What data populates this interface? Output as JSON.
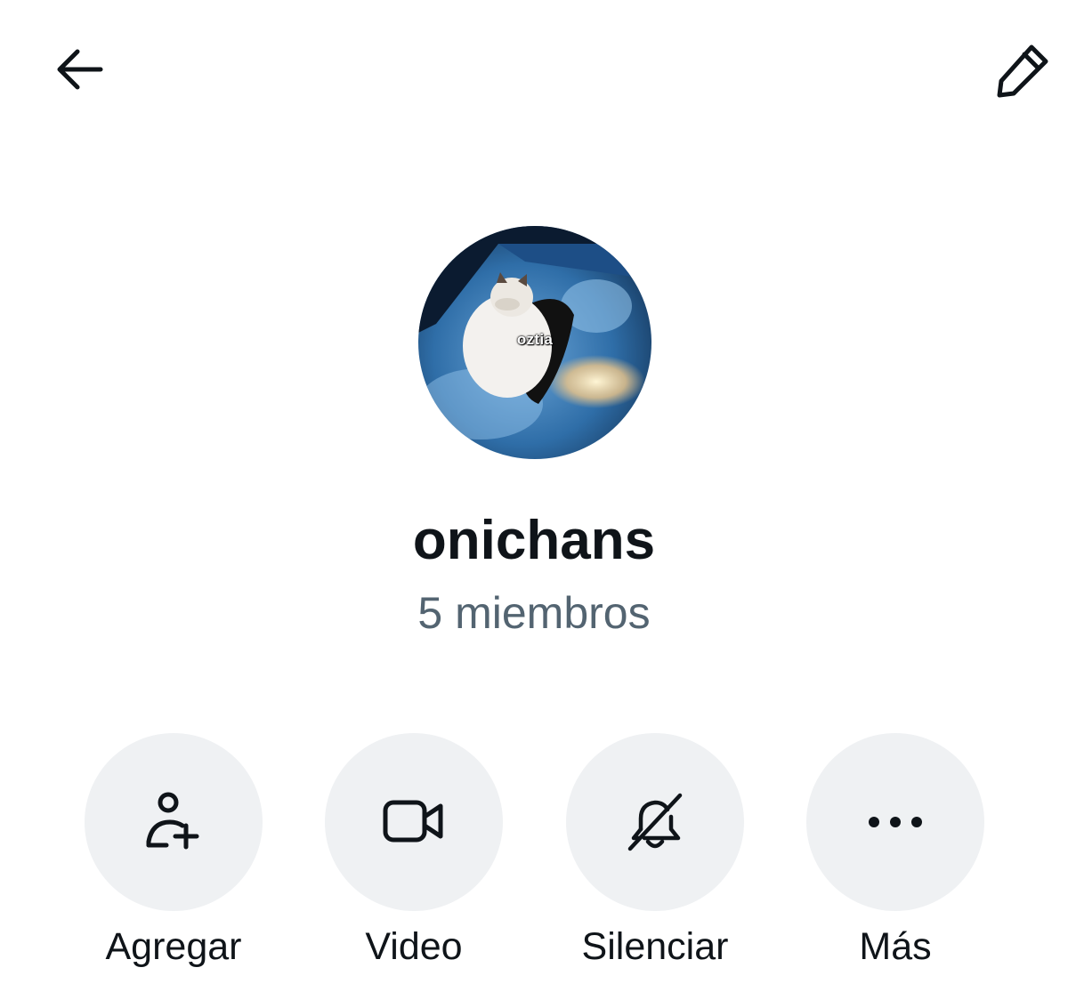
{
  "header": {
    "back_icon": "arrow-left-icon",
    "edit_icon": "pencil-icon"
  },
  "avatar": {
    "caption": "oztia"
  },
  "group": {
    "name": "onichans",
    "members": "5 miembros"
  },
  "actions": [
    {
      "label": "Agregar",
      "icon": "add-person-icon"
    },
    {
      "label": "Video",
      "icon": "video-camera-icon"
    },
    {
      "label": "Silenciar",
      "icon": "bell-off-icon"
    },
    {
      "label": "Más",
      "icon": "more-dots-icon"
    }
  ],
  "colors": {
    "text_primary": "#0f1419",
    "text_secondary": "#536471",
    "button_bg": "#eff1f3",
    "background": "#ffffff"
  }
}
